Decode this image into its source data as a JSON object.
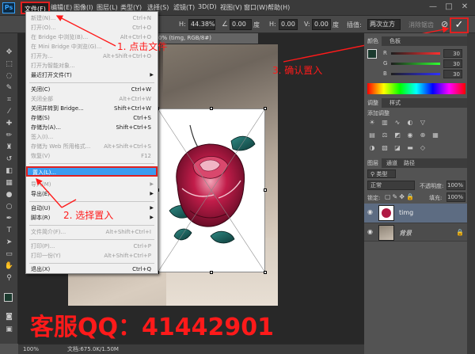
{
  "app": {
    "logo": "Ps"
  },
  "menubar": {
    "file": "文件(F)",
    "edit": "编辑(E)",
    "image": "图像(I)",
    "layer": "图层(L)",
    "type": "类型(Y)",
    "select": "选择(S)",
    "filter": "滤镜(T)",
    "3d": "3D(D)",
    "view": "视图(V)",
    "window": "窗口(W)",
    "help": "帮助(H)",
    "win_controls": [
      "—",
      "□",
      "✕"
    ]
  },
  "optbar": {
    "h_label": "H:",
    "h_value": "44.38%",
    "deg_value": "0.00",
    "deg_unit": "度",
    "h2_label": "H:",
    "h2_value": "0.00",
    "v_label": "V:",
    "v_value": "0.00",
    "deg2_unit": "度",
    "interp_label": "插值:",
    "interp_value": "两次立方",
    "antialias_label": "消除锯齿",
    "cancel_icon": "⃠",
    "commit_icon": "✓"
  },
  "doc": {
    "tab": "0% (timg, RGB/8#)",
    "zoom": "100%",
    "doc_info": "文档:675.0K/1.50M"
  },
  "filemenu": {
    "items": [
      {
        "label": "新建(N)...",
        "shortcut": "Ctrl+N",
        "dis": true
      },
      {
        "label": "打开(O)...",
        "shortcut": "Ctrl+O",
        "dis": true
      },
      {
        "label": "在 Bridge 中浏览(B)...",
        "shortcut": "Alt+Ctrl+O",
        "dis": true
      },
      {
        "label": "在 Mini Bridge 中浏览(G)...",
        "shortcut": "",
        "dis": true
      },
      {
        "label": "打开为...",
        "shortcut": "Alt+Shift+Ctrl+O",
        "dis": true
      },
      {
        "label": "打开为智能对象...",
        "shortcut": "",
        "dis": true
      },
      {
        "label": "最近打开文件(T)",
        "shortcut": "",
        "sub": true,
        "dis": false
      },
      {
        "label": "关闭(C)",
        "shortcut": "Ctrl+W",
        "dis": false
      },
      {
        "label": "关闭全部",
        "shortcut": "Alt+Ctrl+W",
        "dis": true
      },
      {
        "label": "关闭并转到 Bridge...",
        "shortcut": "Shift+Ctrl+W",
        "dis": false
      },
      {
        "label": "存储(S)",
        "shortcut": "Ctrl+S",
        "dis": false
      },
      {
        "label": "存储为(A)...",
        "shortcut": "Shift+Ctrl+S",
        "dis": false
      },
      {
        "label": "签入(I)...",
        "shortcut": "",
        "dis": true
      },
      {
        "label": "存储为 Web 所用格式...",
        "shortcut": "Alt+Shift+Ctrl+S",
        "dis": true
      },
      {
        "label": "恢复(V)",
        "shortcut": "F12",
        "dis": true
      },
      {
        "label": "置入(L)...",
        "shortcut": "",
        "dis": true
      },
      {
        "label": "导入(M)",
        "shortcut": "",
        "sub": true,
        "dis": true
      },
      {
        "label": "导出(E)",
        "shortcut": "",
        "sub": true,
        "dis": false
      },
      {
        "label": "自动(U)",
        "shortcut": "",
        "sub": true,
        "dis": false
      },
      {
        "label": "脚本(R)",
        "shortcut": "",
        "sub": true,
        "dis": false
      },
      {
        "label": "文件简介(F)...",
        "shortcut": "Alt+Shift+Ctrl+I",
        "dis": true
      },
      {
        "label": "打印(P)...",
        "shortcut": "Ctrl+P",
        "dis": true
      },
      {
        "label": "打印一份(Y)",
        "shortcut": "Alt+Shift+Ctrl+P",
        "dis": true
      },
      {
        "label": "退出(X)",
        "shortcut": "Ctrl+Q",
        "dis": false
      }
    ]
  },
  "annotations": {
    "step1": "1. 点击文件",
    "step2": "2. 选择置入",
    "step3": "3. 确认置入",
    "qq": "客服QQ：41442901"
  },
  "color_panel": {
    "tab1": "颜色",
    "tab2": "色板",
    "r": "R",
    "g": "G",
    "b": "B",
    "r_val": "30",
    "g_val": "30",
    "b_val": "30"
  },
  "adj_panel": {
    "tab1": "调整",
    "tab2": "样式",
    "add_label": "添加调整"
  },
  "layers_panel": {
    "tab1": "图层",
    "tab2": "通道",
    "tab3": "路径",
    "kind_label": "类型",
    "blend_mode": "正常",
    "opacity_label": "不透明度:",
    "opacity_value": "100%",
    "lock_label": "锁定:",
    "fill_label": "填充:",
    "fill_value": "100%",
    "layer_top": "timg",
    "layer_bottom": "背景"
  },
  "colors": {
    "accent": "#3b9cf0",
    "annotation": "#ff1a1a"
  }
}
